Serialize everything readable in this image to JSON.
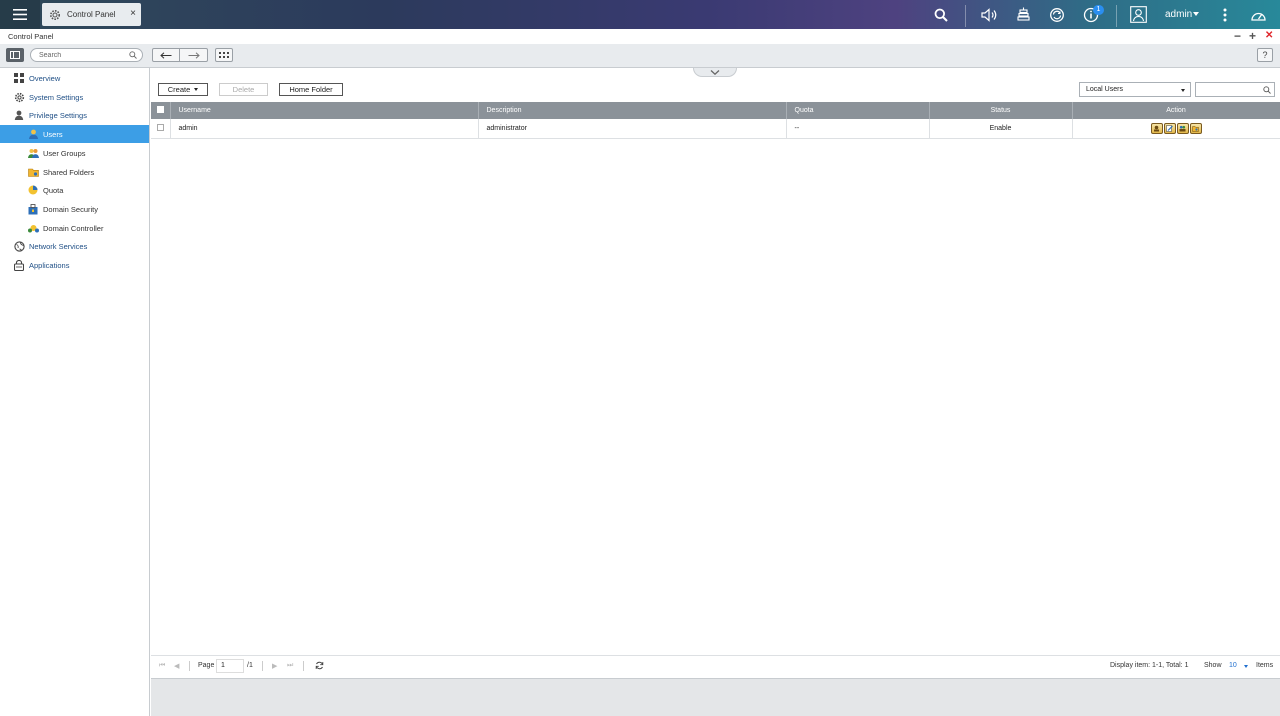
{
  "taskbar": {
    "tab_label": "Control Panel",
    "tab_close": "×",
    "notification_count": "1",
    "user": "admin"
  },
  "window": {
    "title": "Control Panel",
    "minimize": "−",
    "maximize": "+",
    "close": "✕",
    "help": "?"
  },
  "search": {
    "placeholder": "Search"
  },
  "sidebar": {
    "items": [
      {
        "label": "Overview"
      },
      {
        "label": "System Settings"
      },
      {
        "label": "Privilege Settings"
      },
      {
        "label": "Users"
      },
      {
        "label": "User Groups"
      },
      {
        "label": "Shared Folders"
      },
      {
        "label": "Quota"
      },
      {
        "label": "Domain Security"
      },
      {
        "label": "Domain Controller"
      },
      {
        "label": "Network Services"
      },
      {
        "label": "Applications"
      }
    ],
    "active_item": "Users"
  },
  "toolbar": {
    "create": "Create",
    "delete": "Delete",
    "home_folder": "Home Folder",
    "user_type": "Local Users"
  },
  "table": {
    "headers": [
      "Username",
      "Description",
      "Quota",
      "Status",
      "Action"
    ],
    "rows": [
      {
        "username": "admin",
        "description": "administrator",
        "quota": "--",
        "status": "Enable"
      }
    ]
  },
  "footer": {
    "page_label": "Page",
    "page_value": "1",
    "page_total": "/1",
    "display_info": "Display item: 1-1, Total: 1",
    "show_label": "Show",
    "show_value": "10",
    "items_label": "Items",
    "first": "⏮",
    "prev": "◀",
    "next": "▶",
    "last": "⏭"
  },
  "colors": {
    "accent": "#3c9ee6",
    "header_gray": "#8b9299",
    "link_blue": "#1f4f86"
  }
}
